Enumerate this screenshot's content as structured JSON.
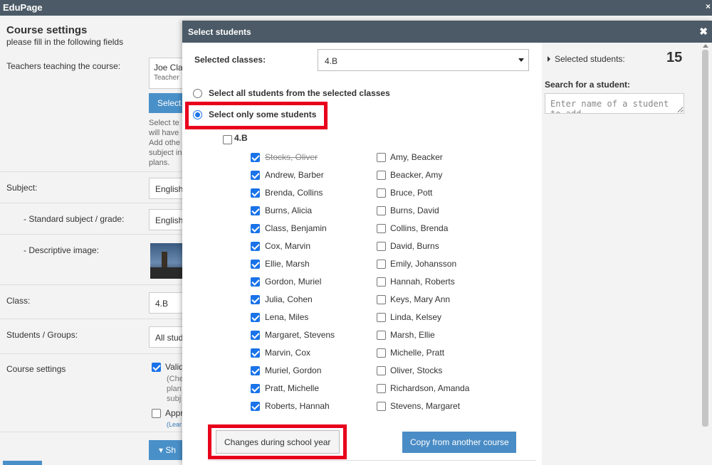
{
  "app": {
    "title": "EduPage",
    "close_glyph": "×"
  },
  "background": {
    "title": "Course settings",
    "subtitle": "please fill in the following fields",
    "teachers_label": "Teachers teaching the course:",
    "teacher_name": "Joe Cla",
    "teacher_role": "Teacher",
    "select_button": "Select",
    "help_text": "Select te will have Add othe subject in plans.",
    "subject_label": "Subject:",
    "subject_value": "English",
    "standard_label": "- Standard subject / grade:",
    "standard_value": "English",
    "image_label": "- Descriptive image:",
    "class_label": "Class:",
    "class_value": "4.B",
    "students_label": "Students / Groups:",
    "students_value": "All stud",
    "course_settings_label": "Course settings",
    "valid_text": "Valid",
    "valid_sub": "(Che plan subj",
    "approve_text": "Appr",
    "learn_link": "(Lear",
    "bottom_button": "Sh"
  },
  "modal": {
    "title": "Select students",
    "close_glyph": "✖",
    "selected_classes_label": "Selected classes:",
    "selected_class_value": "4.B",
    "radio_all": "Select all students from the selected classes",
    "radio_some": "Select only some students",
    "radio_selected": "some",
    "group_name": "4.B",
    "students_left": [
      {
        "name": "Stocks, Oliver",
        "checked": true,
        "strike": true
      },
      {
        "name": "Andrew, Barber",
        "checked": true
      },
      {
        "name": "Brenda, Collins",
        "checked": true
      },
      {
        "name": "Burns, Alicia",
        "checked": true
      },
      {
        "name": "Class, Benjamin",
        "checked": true
      },
      {
        "name": "Cox, Marvin",
        "checked": true
      },
      {
        "name": "Ellie, Marsh",
        "checked": true
      },
      {
        "name": "Gordon, Muriel",
        "checked": true
      },
      {
        "name": "Julia, Cohen",
        "checked": true
      },
      {
        "name": "Lena, Miles",
        "checked": true
      },
      {
        "name": "Margaret, Stevens",
        "checked": true
      },
      {
        "name": "Marvin, Cox",
        "checked": true
      },
      {
        "name": "Muriel, Gordon",
        "checked": true
      },
      {
        "name": "Pratt, Michelle",
        "checked": true
      },
      {
        "name": "Roberts, Hannah",
        "checked": true
      }
    ],
    "students_right": [
      {
        "name": "Amy, Beacker",
        "checked": false
      },
      {
        "name": "Beacker, Amy",
        "checked": false
      },
      {
        "name": "Bruce, Pott",
        "checked": false
      },
      {
        "name": "Burns, David",
        "checked": false
      },
      {
        "name": "Collins, Brenda",
        "checked": false
      },
      {
        "name": "David, Burns",
        "checked": false
      },
      {
        "name": "Emily, Johansson",
        "checked": false
      },
      {
        "name": "Hannah, Roberts",
        "checked": false
      },
      {
        "name": "Keys, Mary Ann",
        "checked": false
      },
      {
        "name": "Linda, Kelsey",
        "checked": false
      },
      {
        "name": "Marsh, Ellie",
        "checked": false
      },
      {
        "name": "Michelle, Pratt",
        "checked": false
      },
      {
        "name": "Oliver, Stocks",
        "checked": false
      },
      {
        "name": "Richardson, Amanda",
        "checked": false
      },
      {
        "name": "Stevens, Margaret",
        "checked": false
      }
    ],
    "changes_button": "Changes during school year",
    "copy_button": "Copy from another course",
    "right_panel": {
      "selected_students_label": "Selected students:",
      "selected_count": "15",
      "search_label": "Search for a student:",
      "search_placeholder": "Enter name of a student to add",
      "search_value": ""
    }
  },
  "colors": {
    "header": "#4b5a66",
    "accent": "#1a73e8",
    "highlight": "#e8001c",
    "primary_button": "#4a8cc5"
  }
}
